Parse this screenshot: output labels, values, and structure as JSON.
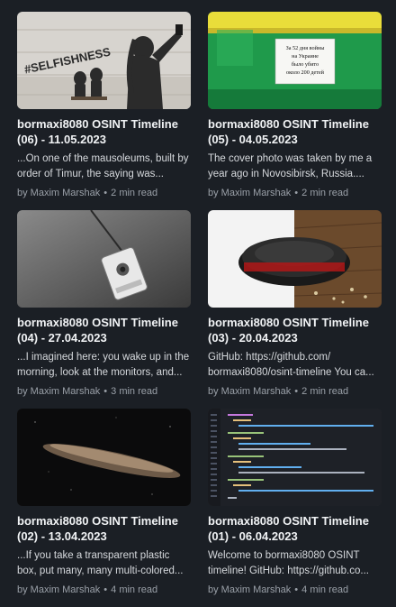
{
  "posts": [
    {
      "title": "bormaxi8080 OSINT Timeline (06) - 11.05.2023",
      "excerpt": "...On one of the mausoleums, built by order of Timur, the saying was...",
      "author": "by Maxim Marshak",
      "read_time": "2 min read",
      "image": "selfishness-graffiti",
      "image_text": "#SELFISHNESS"
    },
    {
      "title": "bormaxi8080 OSINT Timeline (05) - 04.05.2023",
      "excerpt": "The cover photo was taken by me a year ago in Novosibirsk, Russia....",
      "author": "by Maxim Marshak",
      "read_time": "2 min read",
      "image": "kiosk-sign",
      "image_text": [
        "За 52 дня войны",
        "на Украине",
        "было убито",
        "около 200 детей"
      ]
    },
    {
      "title": "bormaxi8080 OSINT Timeline (04) - 27.04.2023",
      "excerpt": "...I imagined here: you wake up in the morning, look at the monitors, and...",
      "author": "by Maxim Marshak",
      "read_time": "3 min read",
      "image": "surveillance-camera"
    },
    {
      "title": "bormaxi8080 OSINT Timeline (03) - 20.04.2023",
      "excerpt": "GitHub: https://github.com/ bormaxi8080/osint-timeline You ca...",
      "author": "by Maxim Marshak",
      "read_time": "2 min read",
      "image": "robot-vacuum"
    },
    {
      "title": "bormaxi8080 OSINT Timeline (02) - 13.04.2023",
      "excerpt": "...If you take a transparent plastic box, put many, many multi-colored...",
      "author": "by Maxim Marshak",
      "read_time": "4 min read",
      "image": "oumuamua-asteroid"
    },
    {
      "title": "bormaxi8080 OSINT Timeline (01) - 06.04.2023",
      "excerpt": "Welcome to bormaxi8080 OSINT timeline! GitHub: https://github.co...",
      "author": "by Maxim Marshak",
      "read_time": "4 min read",
      "image": "code-editor"
    }
  ],
  "colors": {
    "background": "#1b1f25",
    "title": "#f1f3f5",
    "meta": "#9aa0a8"
  }
}
